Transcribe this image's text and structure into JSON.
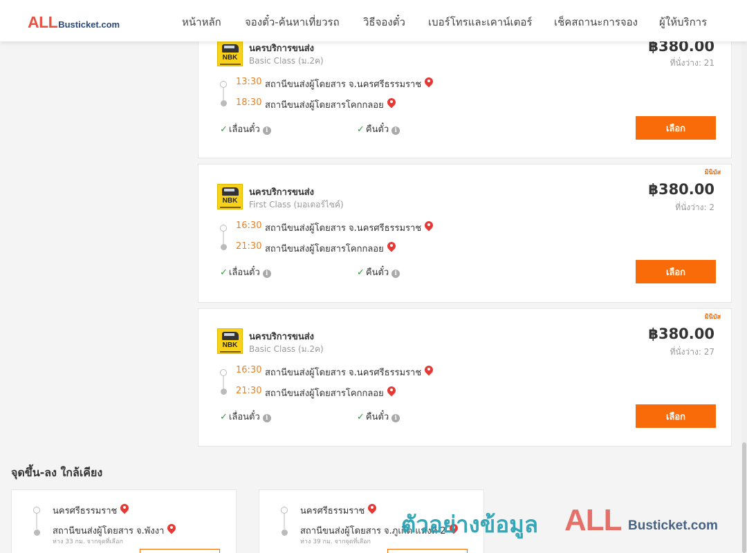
{
  "header": {
    "logo_all": "ALL",
    "logo_rest": "Busticket.com",
    "nav": [
      "หน้าหลัก",
      "จองตั๋ว-ค้นหาเที่ยวรถ",
      "วิธีจองตั๋ว",
      "เบอร์โทรและเคาน์เตอร์",
      "เช็คสถานะการจอง",
      "ผู้ให้บริการ"
    ]
  },
  "trips": [
    {
      "operator": "นครบริการขนส่ง",
      "operator_logo_text": "NBK",
      "class": "Basic Class (ม.2ค)",
      "price": "฿380.00",
      "seats": "ที่นั่งว่าง: 21",
      "badge": "",
      "depart_time": "13:30",
      "depart_station": "สถานีขนส่งผู้โดยสาร จ.นครศรีธรรมราช",
      "arrive_time": "18:30",
      "arrive_station": "สถานีขนส่งผู้โดยสารโคกกลอย",
      "feature_1": "เลื่อนตั๋ว",
      "feature_2": "คืนตั๋ว",
      "button": "เลือก"
    },
    {
      "operator": "นครบริการขนส่ง",
      "operator_logo_text": "NBK",
      "class": "First Class (มอเตอร์ไซค์)",
      "price": "฿380.00",
      "seats": "ที่นั่งว่าง: 2",
      "badge": "มินิบัส",
      "depart_time": "16:30",
      "depart_station": "สถานีขนส่งผู้โดยสาร จ.นครศรีธรรมราช",
      "arrive_time": "21:30",
      "arrive_station": "สถานีขนส่งผู้โดยสารโคกกลอย",
      "feature_1": "เลื่อนตั๋ว",
      "feature_2": "คืนตั๋ว",
      "button": "เลือก"
    },
    {
      "operator": "นครบริการขนส่ง",
      "operator_logo_text": "NBK",
      "class": "Basic Class (ม.2ค)",
      "price": "฿380.00",
      "seats": "ที่นั่งว่าง: 27",
      "badge": "มินิบัส",
      "depart_time": "16:30",
      "depart_station": "สถานีขนส่งผู้โดยสาร จ.นครศรีธรรมราช",
      "arrive_time": "21:30",
      "arrive_station": "สถานีขนส่งผู้โดยสารโคกกลอย",
      "feature_1": "เลื่อนตั๋ว",
      "feature_2": "คืนตั๋ว",
      "button": "เลือก"
    }
  ],
  "nearby": {
    "title": "จุดขึ้น-ลง ใกล้เคียง",
    "items": [
      {
        "from": "นครศรีธรรมราช",
        "to": "สถานีขนส่งผู้โดยสาร จ.พังงา",
        "distance": "ห่าง 33 กม. จากจุดที่เลือก"
      },
      {
        "from": "นครศรีธรรมราช",
        "to": "สถานีขนส่งผู้โดยสาร จ.ภูเก็ต แห่งที่ 2",
        "distance": "ห่าง 39 กม. จากจุดที่เลือก"
      }
    ]
  },
  "watermark": {
    "text": "ตัวอย่างข้อมูล",
    "logo_all": "ALL",
    "logo_rest": "Busticket.com"
  },
  "colors": {
    "accent": "#f96a08",
    "time": "#e8811f",
    "check": "#2e9a3a",
    "pin": "#e53935",
    "logo_red": "#e8523f",
    "logo_navy": "#2a4a7a"
  }
}
